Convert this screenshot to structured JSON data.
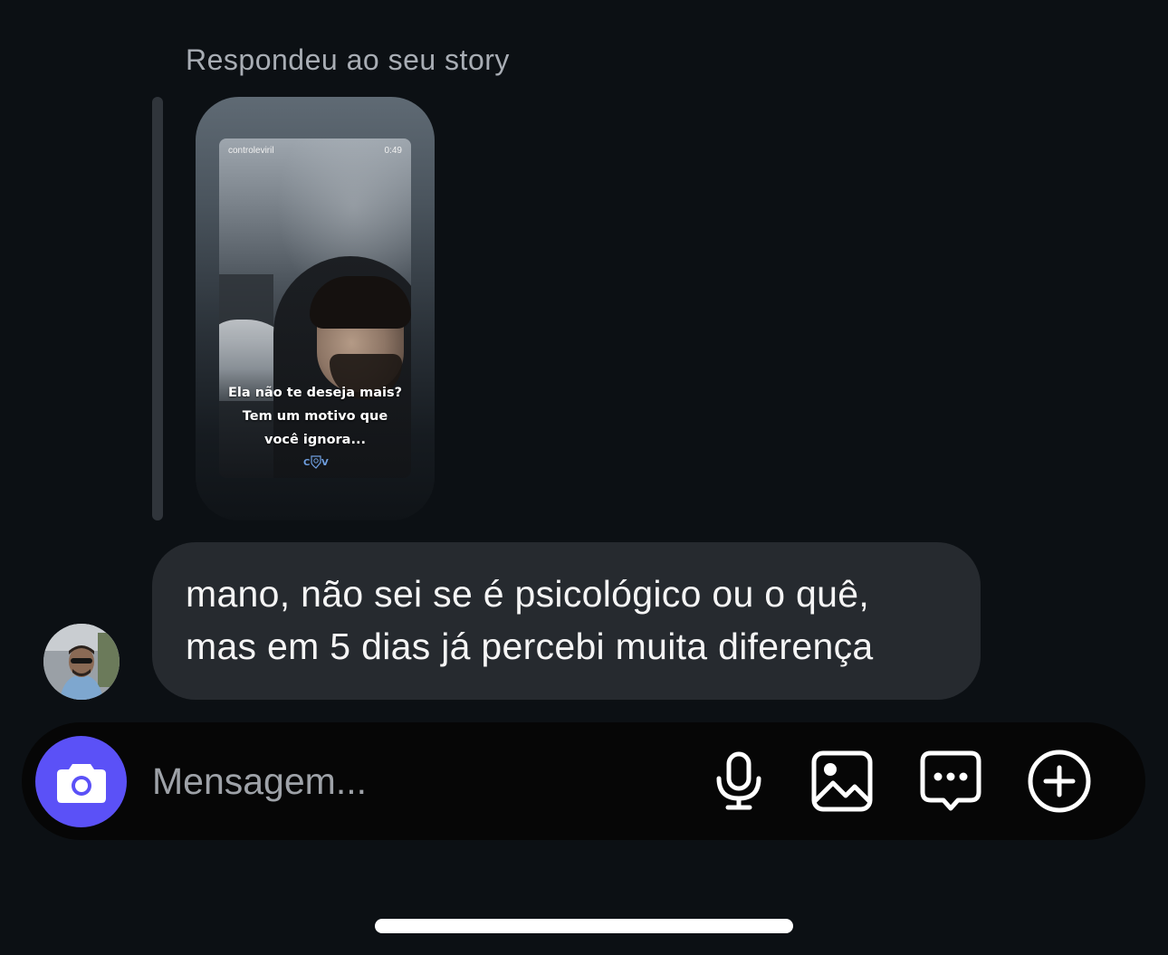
{
  "thread": {
    "reply_label": "Respondeu ao seu story"
  },
  "story": {
    "username": "controleviril",
    "time": "0:49",
    "caption_lines": [
      "Ela não te deseja mais?",
      "Tem um motivo que",
      "você ignora..."
    ],
    "logo_text": "CV"
  },
  "message": {
    "lines": [
      "mano, não sei se é psicológico ou o quê,",
      "mas em 5 dias já percebi muita diferença"
    ]
  },
  "composer": {
    "placeholder": "Mensagem...",
    "value": "",
    "camera_icon": "camera-icon",
    "mic_icon": "microphone-icon",
    "gallery_icon": "image-icon",
    "sticker_icon": "chat-bubble-dots-icon",
    "plus_icon": "plus-circle-icon",
    "accent_color": "#5b51f7"
  },
  "theme": {
    "background": "#0c1014",
    "bubble": "#262a2f"
  }
}
